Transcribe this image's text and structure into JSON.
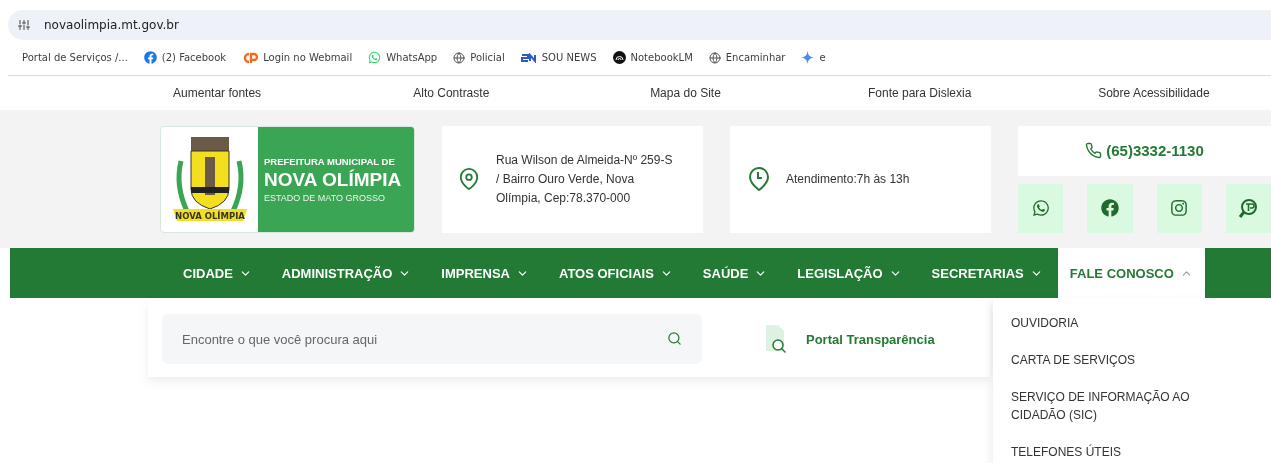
{
  "browser": {
    "url": "novaolimpia.mt.gov.br",
    "bookmarks": [
      {
        "label": "Portal de Serviços /..."
      },
      {
        "label": "(2) Facebook"
      },
      {
        "label": "Login no Webmail"
      },
      {
        "label": "WhatsApp"
      },
      {
        "label": "Policial"
      },
      {
        "label": "SOU NEWS"
      },
      {
        "label": "NotebookLM"
      },
      {
        "label": "Encaminhar"
      },
      {
        "label": "e"
      }
    ]
  },
  "accessibility_bar": [
    "Aumentar fontes",
    "Alto Contraste",
    "Mapa do Site",
    "Fonte para Dislexia",
    "Sobre Acessibilidade"
  ],
  "header": {
    "logo": {
      "line_1": "PREFEITURA MUNICIPAL DE",
      "line_2": "NOVA OLÍMPIA",
      "line_3": "ESTADO DE MATO GROSSO",
      "crest_ribbon": "NOVA OLÍMPIA"
    },
    "address": "Rua Wilson de Almeida-Nº 259-S / Bairro Ouro Verde, Nova Olímpia, Cep:78.370-000",
    "hours": "Atendimento:7h às 13h",
    "phone": "(65)3332-1130"
  },
  "nav": [
    {
      "label": "CIDADE",
      "expanded": false
    },
    {
      "label": "ADMINISTRAÇÃO",
      "expanded": false
    },
    {
      "label": "IMPRENSA",
      "expanded": false
    },
    {
      "label": "ATOS OFICIAIS",
      "expanded": false
    },
    {
      "label": "SAÚDE",
      "expanded": false
    },
    {
      "label": "LEGISLAÇÃO",
      "expanded": false
    },
    {
      "label": "SECRETARIAS",
      "expanded": false
    },
    {
      "label": "FALE CONOSCO",
      "expanded": true
    }
  ],
  "dropdown": [
    "OUVIDORIA",
    "CARTA DE SERVIÇOS",
    "SERVIÇO DE INFORMAÇÃO AO CIDADÃO (SIC)",
    "TELEFONES ÚTEIS"
  ],
  "search": {
    "placeholder": "Encontre o que você procura aqui"
  },
  "transparency_link": "Portal Transparência"
}
